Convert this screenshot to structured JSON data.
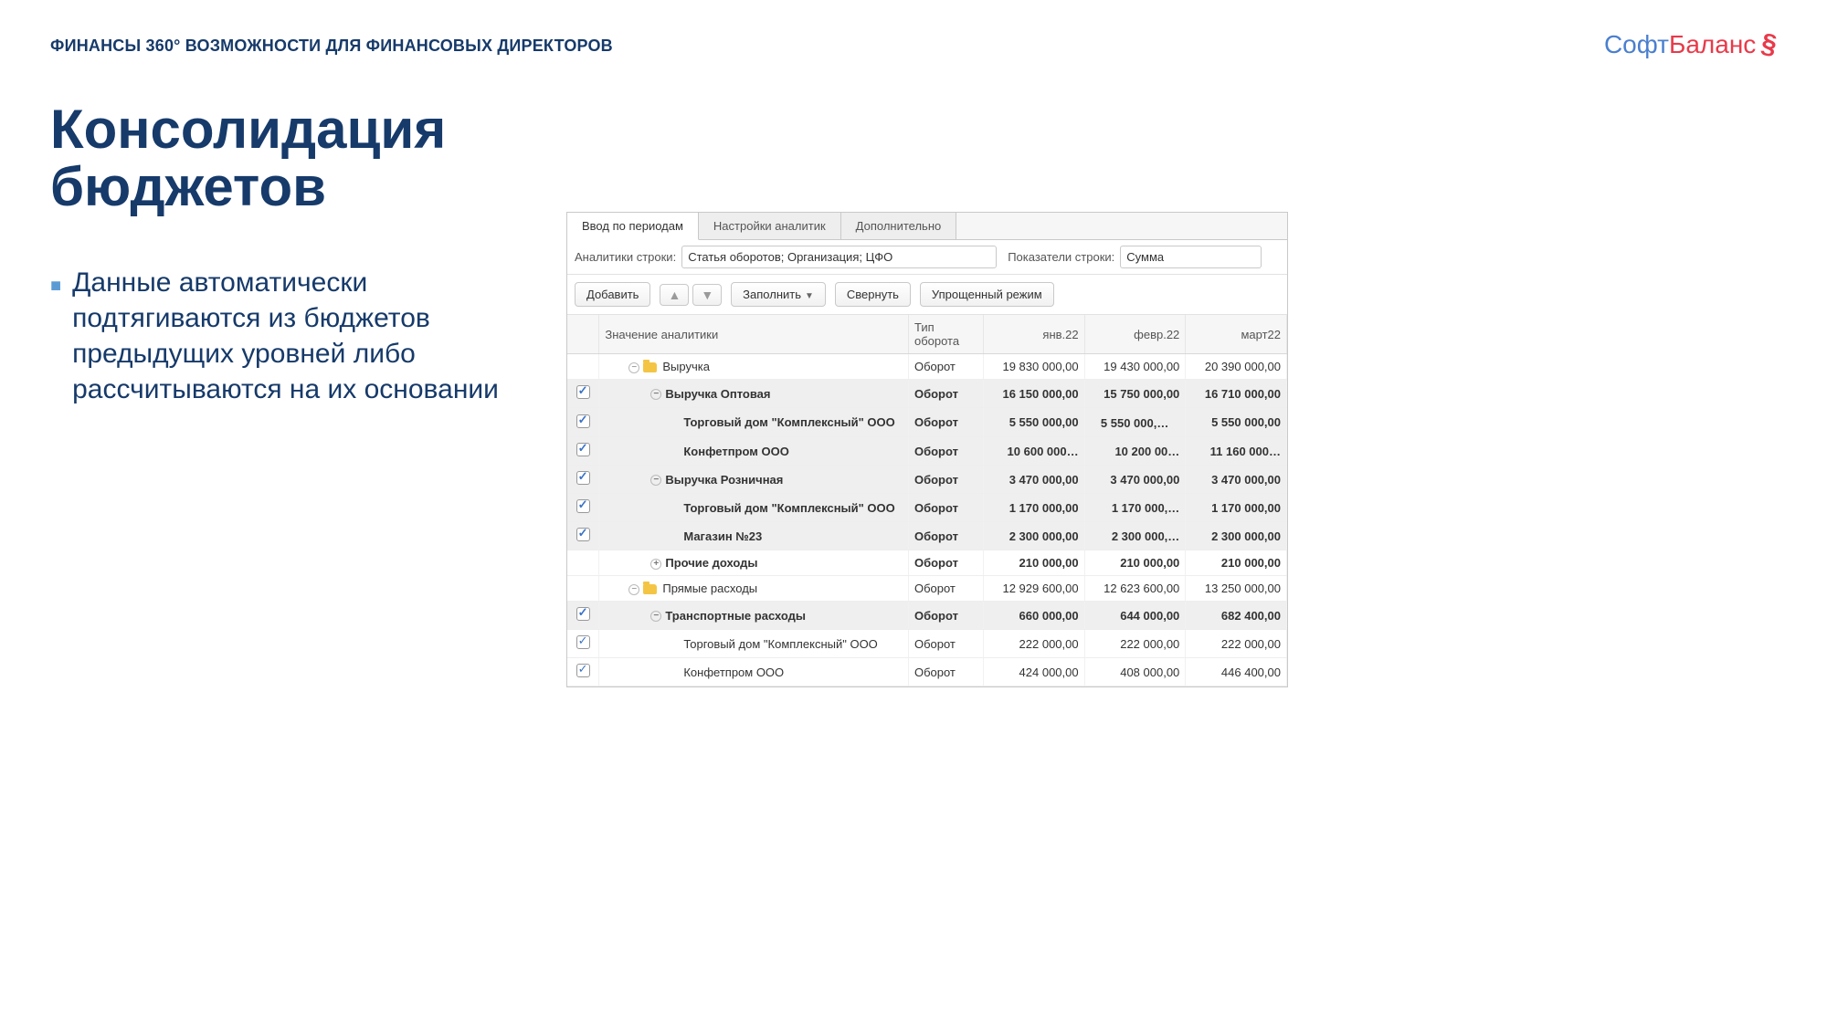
{
  "header": "ФИНАНСЫ 360° ВОЗМОЖНОСТИ ДЛЯ ФИНАНСОВЫХ ДИРЕКТОРОВ",
  "logo": {
    "part1": "Софт",
    "part2": "Баланс"
  },
  "title_line1": "Консолидация",
  "title_line2": "бюджетов",
  "bullet": "Данные автоматически подтягиваются из бюджетов предыдущих уровней либо рассчитываются на их основании",
  "tabs": [
    "Ввод по периодам",
    "Настройки аналитик",
    "Дополнительно"
  ],
  "filters": {
    "row_analytics_label": "Аналитики строки:",
    "row_analytics_value": "Статья оборотов; Организация; ЦФО",
    "row_indicators_label": "Показатели строки:",
    "row_indicators_value": "Сумма"
  },
  "toolbar": {
    "add": "Добавить",
    "fill": "Заполнить",
    "collapse": "Свернуть",
    "simple": "Упрощенный режим"
  },
  "columns": {
    "name": "Значение аналитики",
    "type": "Тип оборота",
    "m1": "янв.22",
    "m2": "февр.22",
    "m3": "март22"
  },
  "type_value": "Оборот",
  "rows": [
    {
      "level": 1,
      "chk": false,
      "shade": false,
      "bold": false,
      "folder": true,
      "exp": "-",
      "name": "Выручка",
      "v1": "19 830 000,00",
      "v2": "19 430 000,00",
      "v3": "20 390 000,00"
    },
    {
      "level": 2,
      "chk": true,
      "shade": true,
      "bold": true,
      "folder": false,
      "exp": "-",
      "name": "Выручка Оптовая",
      "v1": "16 150 000,00",
      "v2": "15 750 000,00",
      "v3": "16 710 000,00"
    },
    {
      "level": 3,
      "chk": true,
      "shade": true,
      "bold": true,
      "folder": false,
      "exp": "",
      "name": "Торговый дом \"Комплексный\" ООО",
      "v1": "5 550 000,00",
      "v2": "5 550 000,…ﾠ",
      "v3": "5 550 000,00"
    },
    {
      "level": 3,
      "chk": true,
      "shade": true,
      "bold": true,
      "folder": false,
      "exp": "",
      "name": "Конфетпром ООО",
      "v1": "10 600 000…",
      "v2": "10 200 00…",
      "v3": "11 160 000…"
    },
    {
      "level": 2,
      "chk": true,
      "shade": true,
      "bold": true,
      "folder": false,
      "exp": "-",
      "name": "Выручка Розничная",
      "v1": "3 470 000,00",
      "v2": "3 470 000,00",
      "v3": "3 470 000,00"
    },
    {
      "level": 3,
      "chk": true,
      "shade": true,
      "bold": true,
      "folder": false,
      "exp": "",
      "name": "Торговый дом \"Комплексный\" ООО",
      "v1": "1 170 000,00",
      "v2": "1 170 000,…",
      "v3": "1 170 000,00"
    },
    {
      "level": 3,
      "chk": true,
      "shade": true,
      "bold": true,
      "folder": false,
      "exp": "",
      "name": "Магазин №23",
      "v1": "2 300 000,00",
      "v2": "2 300 000,…",
      "v3": "2 300 000,00"
    },
    {
      "level": 2,
      "chk": false,
      "shade": false,
      "bold": true,
      "folder": false,
      "exp": "+",
      "name": "Прочие доходы",
      "v1": "210 000,00",
      "v2": "210 000,00",
      "v3": "210 000,00"
    },
    {
      "level": 1,
      "chk": false,
      "shade": false,
      "bold": false,
      "folder": true,
      "exp": "-",
      "name": "Прямые расходы",
      "v1": "12 929 600,00",
      "v2": "12 623 600,00",
      "v3": "13 250 000,00"
    },
    {
      "level": 2,
      "chk": true,
      "shade": true,
      "bold": true,
      "folder": false,
      "exp": "-",
      "name": "Транспортные расходы",
      "v1": "660 000,00",
      "v2": "644 000,00",
      "v3": "682 400,00"
    },
    {
      "level": 3,
      "chk": true,
      "shade": false,
      "bold": false,
      "folder": false,
      "exp": "",
      "name": "Торговый дом \"Комплексный\" ООО",
      "v1": "222 000,00",
      "v2": "222 000,00",
      "v3": "222 000,00"
    },
    {
      "level": 3,
      "chk": true,
      "shade": false,
      "bold": false,
      "folder": false,
      "exp": "",
      "name": "Конфетпром ООО",
      "v1": "424 000,00",
      "v2": "408 000,00",
      "v3": "446 400,00"
    }
  ]
}
